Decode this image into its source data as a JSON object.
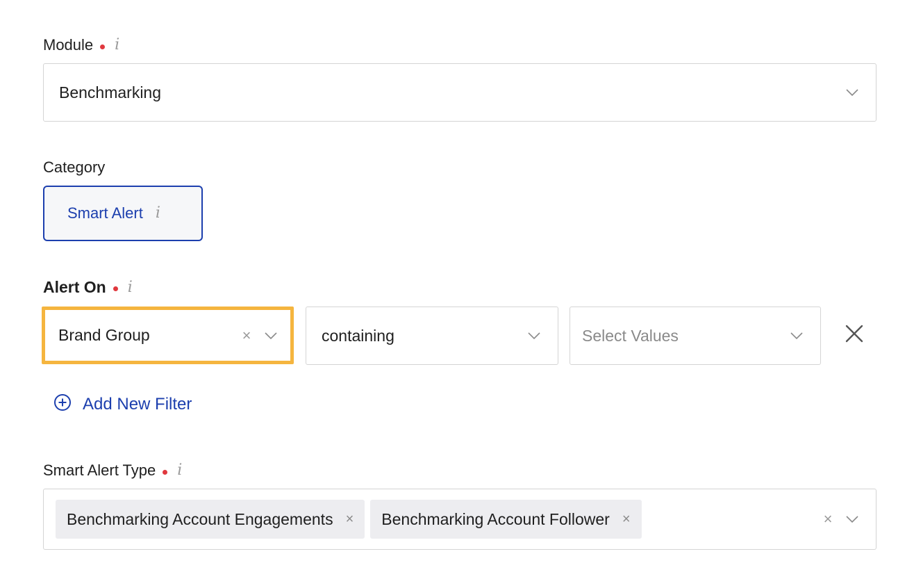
{
  "module": {
    "label": "Module",
    "required": true,
    "info_icon": "i",
    "value": "Benchmarking"
  },
  "category": {
    "label": "Category",
    "selected": "Smart Alert",
    "info_icon": "i"
  },
  "alert_on": {
    "label": "Alert On",
    "required": true,
    "info_icon": "i",
    "field": "Brand Group",
    "operator": "containing",
    "values_placeholder": "Select Values",
    "add_filter_label": "Add New Filter"
  },
  "smart_alert_type": {
    "label": "Smart Alert Type",
    "required": true,
    "info_icon": "i",
    "tags": [
      "Benchmarking Account Engagements",
      "Benchmarking Account Follower"
    ]
  },
  "icons": {
    "clear": "×"
  },
  "colors": {
    "accent": "#1c3fae",
    "required_dot": "#e0383e",
    "focus_highlight": "#f5b53f",
    "border": "#d4d4d4",
    "tag_bg": "#ededf0"
  }
}
